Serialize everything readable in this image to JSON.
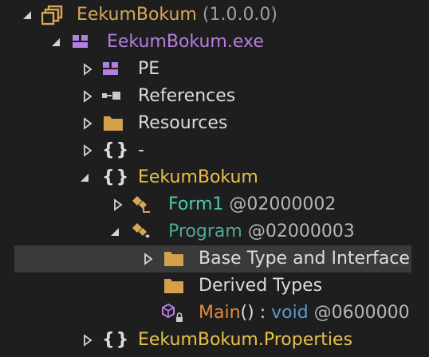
{
  "colors": {
    "background": "#1e1e1e",
    "selection": "#3a3a3a",
    "assembly": "#d8a657",
    "module": "#b47fe0",
    "namespace": "#e5c24a",
    "type": "#4ec9b0",
    "method": "#e48a3a",
    "keyword": "#569cd6"
  },
  "tree": {
    "assembly": {
      "name": "EekumBokum",
      "version": "(1.0.0.0)",
      "icon": "assembly-icon"
    },
    "module": {
      "name": "EekumBokum.exe",
      "icon": "module-icon"
    },
    "pe": {
      "label": "PE",
      "icon": "pe-icon"
    },
    "references": {
      "label": "References",
      "icon": "references-icon"
    },
    "resources": {
      "label": "Resources",
      "icon": "folder-icon"
    },
    "ns_empty": {
      "label": "-",
      "icon": "namespace-icon"
    },
    "ns_main": {
      "label": "EekumBokum",
      "icon": "namespace-icon"
    },
    "form1": {
      "name": "Form1",
      "token": "@02000002",
      "icon": "class-icon"
    },
    "program": {
      "name": "Program",
      "token": "@02000003",
      "icon": "static-class-icon"
    },
    "base_types": {
      "label": "Base Type and Interface",
      "icon": "folder-icon"
    },
    "derived_types": {
      "label": "Derived Types",
      "icon": "folder-icon"
    },
    "main_method": {
      "name": "Main",
      "parens": "()",
      "sep": " : ",
      "ret": "void",
      "token": "@0600000",
      "icon": "method-icon"
    },
    "ns_props": {
      "label": "EekumBokum.Properties",
      "icon": "namespace-icon"
    }
  }
}
